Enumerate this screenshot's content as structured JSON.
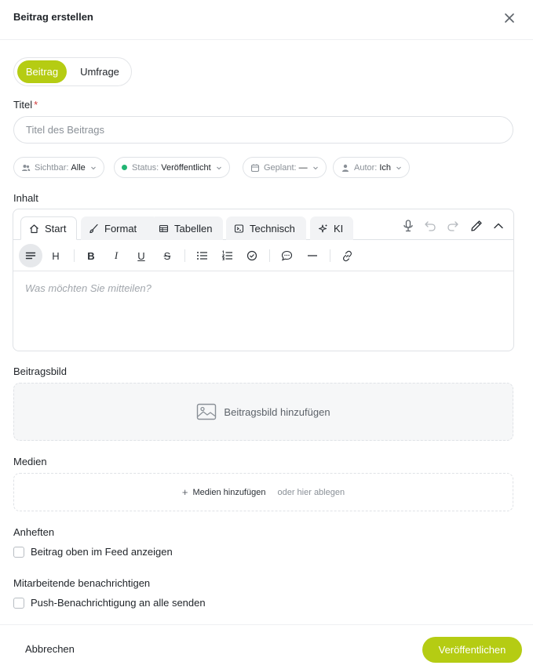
{
  "header": {
    "title": "Beitrag erstellen"
  },
  "type_switch": {
    "items": [
      {
        "label": "Beitrag",
        "active": true
      },
      {
        "label": "Umfrage",
        "active": false
      }
    ]
  },
  "title_field": {
    "label": "Titel",
    "required_mark": "*",
    "placeholder": "Titel des Beitrags",
    "value": ""
  },
  "chips": {
    "visibility": {
      "label": "Sichtbar:",
      "value": "Alle",
      "icon": "users-icon"
    },
    "status": {
      "label": "Status:",
      "value": "Veröffentlicht",
      "color": "#22b573"
    },
    "scheduled": {
      "label": "Geplant:",
      "value": "—",
      "icon": "calendar-icon"
    },
    "author": {
      "label": "Autor:",
      "value": "Ich",
      "icon": "user-icon"
    }
  },
  "content": {
    "label": "Inhalt",
    "tabs": [
      {
        "label": "Start",
        "icon": "home-icon",
        "active": true
      },
      {
        "label": "Format",
        "icon": "brush-icon",
        "active": false
      },
      {
        "label": "Tabellen",
        "icon": "table-icon",
        "active": false
      },
      {
        "label": "Technisch",
        "icon": "terminal-icon",
        "active": false
      },
      {
        "label": "KI",
        "icon": "sparkle-icon",
        "active": false
      }
    ],
    "toolbar": {
      "heading": "H",
      "bold": "B",
      "italic": "I",
      "underline": "U",
      "strike": "S"
    },
    "placeholder": "Was möchten Sie mitteilen?"
  },
  "cover_image": {
    "label": "Beitragsbild",
    "action": "Beitragsbild hinzufügen"
  },
  "media": {
    "label": "Medien",
    "action": "Medien hinzufügen",
    "hint": "oder hier ablegen"
  },
  "pin": {
    "label": "Anheften",
    "checkbox": "Beitrag oben im Feed anzeigen",
    "checked": false
  },
  "notify": {
    "label": "Mitarbeitende benachrichtigen",
    "checkbox": "Push-Benachrichtigung an alle senden",
    "checked": false
  },
  "footer": {
    "cancel": "Abbrechen",
    "publish": "Veröffentlichen"
  },
  "colors": {
    "accent": "#b5cc13",
    "required": "#d23c3c",
    "status_dot": "#22b573"
  }
}
